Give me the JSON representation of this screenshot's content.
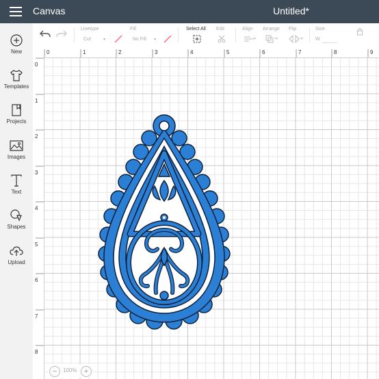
{
  "header": {
    "app_title": "Canvas",
    "doc_title": "Untitled*"
  },
  "sidebar": {
    "items": [
      {
        "label": "New",
        "icon": "plus-circle-icon"
      },
      {
        "label": "Templates",
        "icon": "shirt-icon"
      },
      {
        "label": "Projects",
        "icon": "bookmark-book-icon"
      },
      {
        "label": "Images",
        "icon": "image-icon"
      },
      {
        "label": "Text",
        "icon": "text-t-icon"
      },
      {
        "label": "Shapes",
        "icon": "shapes-icon"
      },
      {
        "label": "Upload",
        "icon": "cloud-upload-icon"
      }
    ]
  },
  "toolbar": {
    "linetype": {
      "label": "Linetype",
      "value": "Cut"
    },
    "fill": {
      "label": "Fill",
      "value": "No Fill"
    },
    "select_all": {
      "label": "Select All"
    },
    "edit": {
      "label": "Edit"
    },
    "align": {
      "label": "Align"
    },
    "arrange": {
      "label": "Arrange"
    },
    "flip": {
      "label": "Flip"
    },
    "size": {
      "label": "Size",
      "w": "W"
    }
  },
  "rulers": {
    "top": [
      "0",
      "1",
      "2",
      "3",
      "4",
      "5",
      "6",
      "7",
      "8",
      "9"
    ],
    "left": [
      "0",
      "1",
      "2",
      "3",
      "4",
      "5",
      "6",
      "7",
      "8"
    ]
  },
  "zoom": {
    "value": "100%",
    "minus": "−",
    "plus": "+"
  },
  "colors": {
    "header_bg": "#3c4a58",
    "design_fill": "#2b7fd4",
    "design_outline": "#0d1f3a"
  }
}
